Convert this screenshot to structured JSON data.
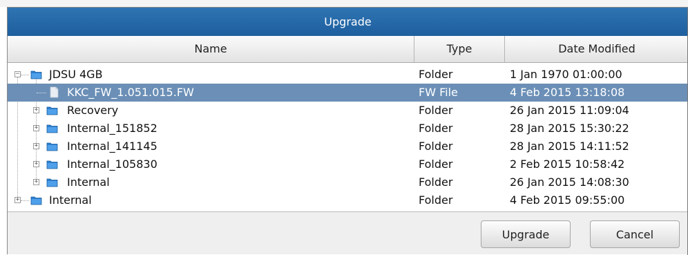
{
  "dialog": {
    "title": "Upgrade"
  },
  "columns": {
    "name": "Name",
    "type": "Type",
    "date": "Date Modified"
  },
  "rows": [
    {
      "name": "JDSU 4GB",
      "type": "Folder",
      "date": "1 Jan 1970 01:00:00",
      "icon": "folder-icon",
      "expander": "−"
    },
    {
      "name": "KKC_FW_1.051.015.FW",
      "type": "FW File",
      "date": "4 Feb 2015 13:18:08",
      "icon": "file-icon",
      "selected": true
    },
    {
      "name": "Recovery",
      "type": "Folder",
      "date": "26 Jan 2015 11:09:04",
      "icon": "folder-icon",
      "expander": "+"
    },
    {
      "name": "Internal_151852",
      "type": "Folder",
      "date": "28 Jan 2015 15:30:22",
      "icon": "folder-icon",
      "expander": "+"
    },
    {
      "name": "Internal_141145",
      "type": "Folder",
      "date": "28 Jan 2015 14:11:52",
      "icon": "folder-icon",
      "expander": "+"
    },
    {
      "name": "Internal_105830",
      "type": "Folder",
      "date": "2 Feb 2015 10:58:42",
      "icon": "folder-icon",
      "expander": "+"
    },
    {
      "name": "Internal",
      "type": "Folder",
      "date": "26 Jan 2015 14:08:30",
      "icon": "folder-icon",
      "expander": "+"
    },
    {
      "name": "Internal",
      "type": "Folder",
      "date": "4 Feb 2015 09:55:00",
      "icon": "folder-icon",
      "expander": "+"
    }
  ],
  "buttons": {
    "upgrade": "Upgrade",
    "cancel": "Cancel"
  },
  "colors": {
    "titlebar": "#2569a8",
    "selection": "#6b8fb6",
    "folder": "#2b7fd0"
  }
}
